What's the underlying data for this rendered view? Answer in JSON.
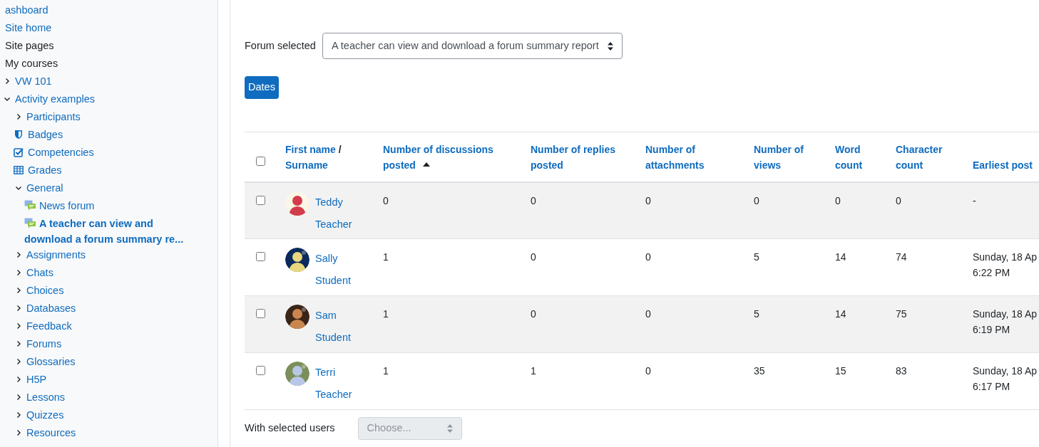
{
  "sidebar": {
    "items": [
      {
        "label": "ashboard",
        "kind": "link"
      },
      {
        "label": "Site home",
        "kind": "link"
      },
      {
        "label": "Site pages",
        "kind": "text"
      },
      {
        "label": "My courses",
        "kind": "text",
        "children": [
          {
            "label": "VW 101",
            "kind": "branch",
            "expanded": false
          },
          {
            "label": "Activity examples",
            "kind": "branch",
            "expanded": true,
            "children": [
              {
                "label": "Participants",
                "kind": "branch",
                "expanded": false
              },
              {
                "label": "Badges",
                "kind": "badge"
              },
              {
                "label": "Competencies",
                "kind": "competency"
              },
              {
                "label": "Grades",
                "kind": "grades"
              },
              {
                "label": "General",
                "kind": "branch",
                "expanded": true,
                "children": [
                  {
                    "label": "News forum",
                    "kind": "forum",
                    "selected": false
                  },
                  {
                    "label": "A teacher can view and download a forum summary re...",
                    "kind": "forum",
                    "selected": true
                  }
                ]
              },
              {
                "label": "Assignments",
                "kind": "branch",
                "expanded": false
              },
              {
                "label": "Chats",
                "kind": "branch",
                "expanded": false
              },
              {
                "label": "Choices",
                "kind": "branch",
                "expanded": false
              },
              {
                "label": "Databases",
                "kind": "branch",
                "expanded": false
              },
              {
                "label": "Feedback",
                "kind": "branch",
                "expanded": false
              },
              {
                "label": "Forums",
                "kind": "branch",
                "expanded": false
              },
              {
                "label": "Glossaries",
                "kind": "branch",
                "expanded": false
              },
              {
                "label": "H5P",
                "kind": "branch",
                "expanded": false
              },
              {
                "label": "Lessons",
                "kind": "branch",
                "expanded": false
              },
              {
                "label": "Quizzes",
                "kind": "branch",
                "expanded": false
              },
              {
                "label": "Resources",
                "kind": "branch",
                "expanded": false
              }
            ]
          }
        ]
      }
    ]
  },
  "forum_select": {
    "label": "Forum selected",
    "value": "A teacher can view and download a forum summary report"
  },
  "dates_button": "Dates",
  "table": {
    "select_all": {
      "checked": false
    },
    "name_column": {
      "first": "First name",
      "separator": "/",
      "second": "Surname"
    },
    "columns": [
      {
        "label": "Number of discussions posted",
        "sorted": true
      },
      {
        "label": "Number of replies posted",
        "sorted": false
      },
      {
        "label": "Number of attachments",
        "sorted": false
      },
      {
        "label": "Number of views",
        "sorted": false
      },
      {
        "label": "Word count",
        "sorted": false
      },
      {
        "label": "Character count",
        "sorted": false
      },
      {
        "label": "Earliest post",
        "sorted": false
      }
    ],
    "rows": [
      {
        "checked": false,
        "name": "Teddy Teacher",
        "cells": [
          "0",
          "0",
          "0",
          "0",
          "0",
          "0",
          "-"
        ]
      },
      {
        "checked": false,
        "name": "Sally Student",
        "cells": [
          "1",
          "0",
          "0",
          "5",
          "14",
          "74",
          "Sunday, 18 Ap\n6:22 PM"
        ]
      },
      {
        "checked": false,
        "name": "Sam Student",
        "cells": [
          "1",
          "0",
          "0",
          "5",
          "14",
          "75",
          "Sunday, 18 Ap\n6:19 PM"
        ]
      },
      {
        "checked": false,
        "name": "Terri Teacher",
        "cells": [
          "1",
          "1",
          "0",
          "35",
          "15",
          "83",
          "Sunday, 18 Ap\n6:17 PM"
        ]
      }
    ]
  },
  "bulk_action": {
    "label": "With selected users",
    "placeholder": "Choose...",
    "disabled": true
  }
}
